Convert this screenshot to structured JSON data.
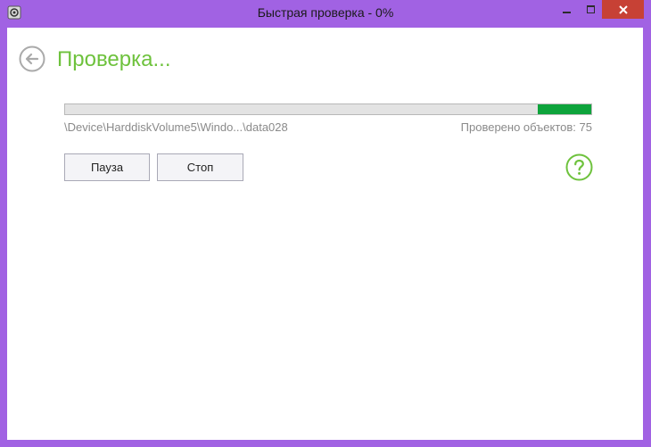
{
  "window": {
    "title": "Быстрая проверка - 0%"
  },
  "colors": {
    "frame": "#a162e3",
    "accent": "#6ec23d",
    "progress": "#0ea43c",
    "close": "#c74135"
  },
  "header": {
    "title": "Проверка..."
  },
  "progress": {
    "fraction": 0.03,
    "path": "\\Device\\HarddiskVolume5\\Windo...\\data028",
    "count_text": "Проверено объектов: 75"
  },
  "buttons": {
    "pause": "Пауза",
    "stop": "Стоп"
  },
  "icons": {
    "app": "app-icon",
    "back": "back-arrow-icon",
    "help": "help-question-icon",
    "minimize": "minimize-icon",
    "maximize": "maximize-icon",
    "close": "close-icon"
  }
}
